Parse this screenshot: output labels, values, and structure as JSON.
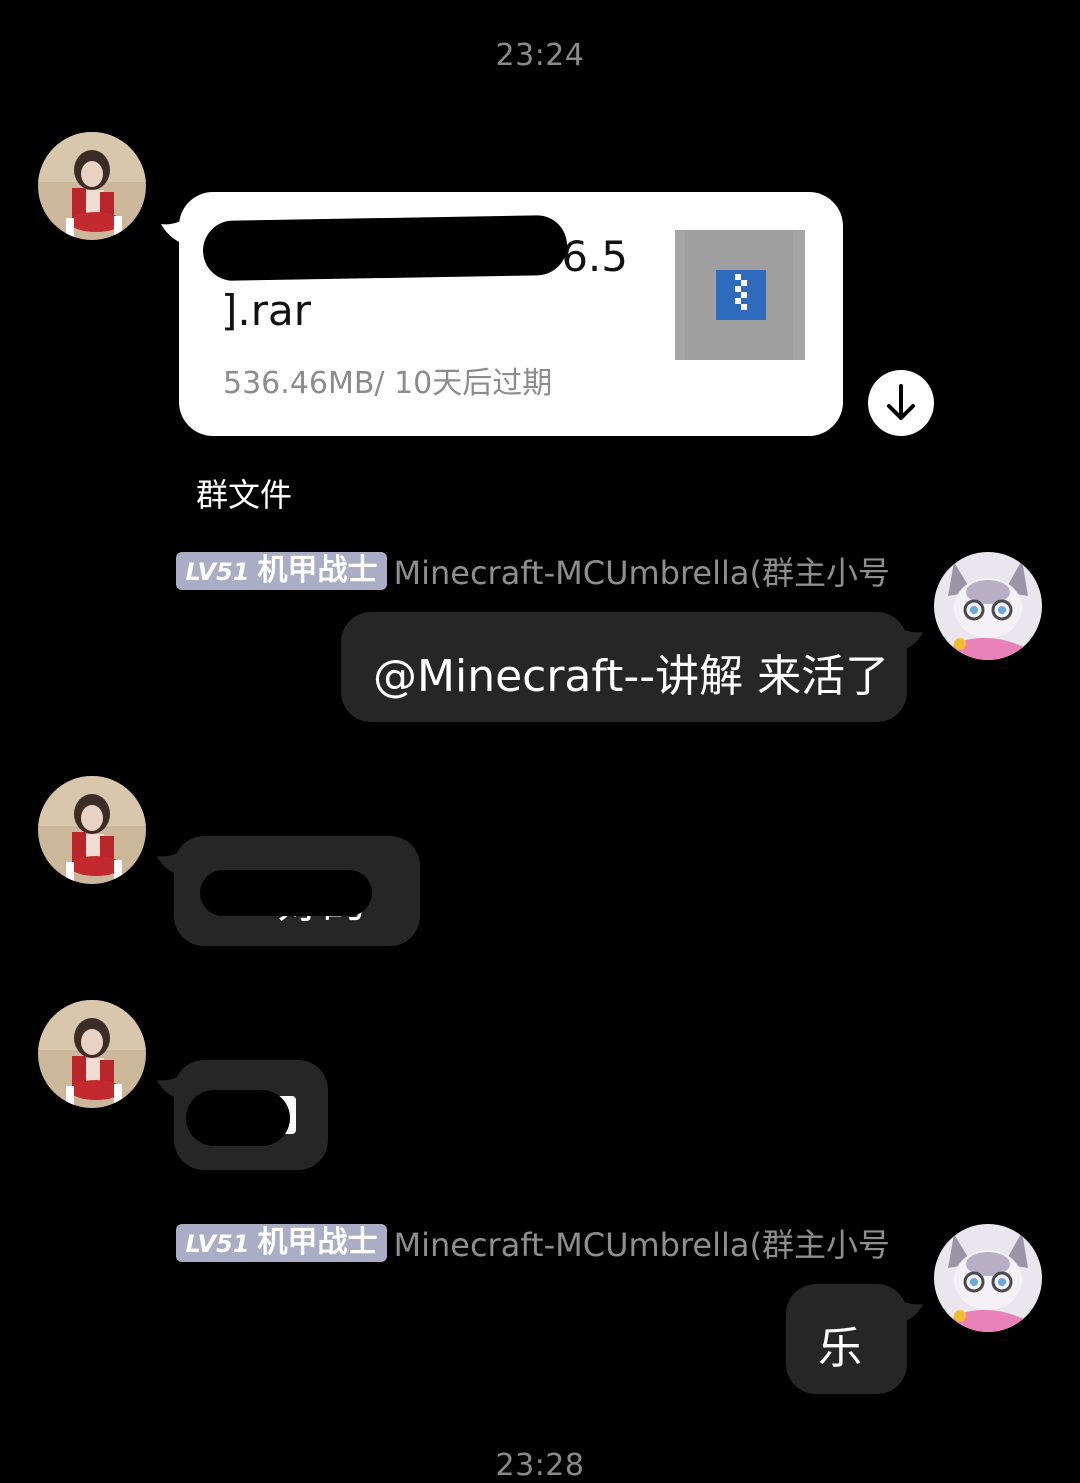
{
  "timestamps": {
    "top": "23:24",
    "bottom": "23:28"
  },
  "file_message": {
    "name_visible_part1": "6.5",
    "name_visible_part2": "].rar",
    "meta": "536.46MB/ 10天后过期",
    "source_label": "群文件",
    "thumb_icon": "zip-archive-icon",
    "download_icon": "download-arrow-icon"
  },
  "sender_1": {
    "level": "LV51",
    "title": "机甲战士",
    "name": "Minecraft-MCUmbrella(群主小号"
  },
  "message_mention": "@Minecraft--讲解 来活了",
  "message_ok_visible": "好的",
  "message_short_visible": "",
  "sender_2": {
    "level": "LV51",
    "title": "机甲战士",
    "name": "Minecraft-MCUmbrella(群主小号"
  },
  "message_le": "乐",
  "colors": {
    "background": "#000000",
    "bubble": "#262626",
    "file_card": "#ffffff",
    "badge": "#a9aec6",
    "zip_blue": "#2f6bbd"
  }
}
